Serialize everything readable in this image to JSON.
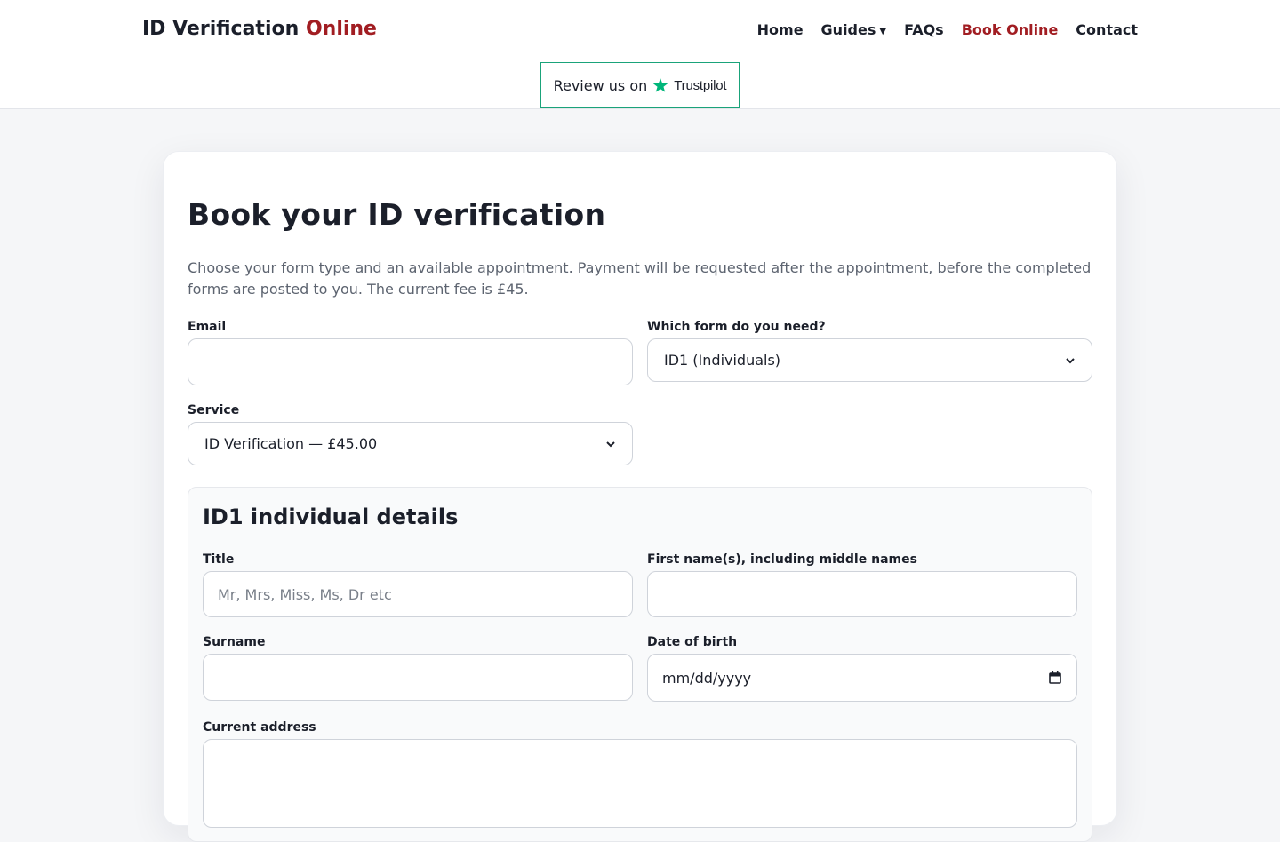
{
  "header": {
    "brand_main": "ID Verification",
    "brand_accent": "Online",
    "nav": [
      {
        "label": "Home"
      },
      {
        "label": "Guides",
        "has_dropdown": true
      },
      {
        "label": "FAQs"
      },
      {
        "label": "Book Online",
        "active": true
      },
      {
        "label": "Contact"
      }
    ],
    "trustpilot": {
      "prefix": "Review us on",
      "brand": "Trustpilot"
    }
  },
  "main": {
    "title": "Book your ID verification",
    "intro": "Choose your form type and an available appointment. Payment will be requested after the appointment, before the completed forms are posted to you. The current fee is £45.",
    "email": {
      "label": "Email",
      "value": "",
      "placeholder": ""
    },
    "form_type": {
      "label": "Which form do you need?",
      "selected": "ID1 (Individuals)"
    },
    "service": {
      "label": "Service",
      "selected": "ID Verification — £45.00"
    },
    "details": {
      "heading": "ID1 individual details",
      "title_field": {
        "label": "Title",
        "placeholder": "Mr, Mrs, Miss, Ms, Dr etc"
      },
      "first_names": {
        "label": "First name(s), including middle names",
        "value": ""
      },
      "surname": {
        "label": "Surname",
        "value": ""
      },
      "dob": {
        "label": "Date of birth",
        "placeholder": "mm/dd/yyyy"
      },
      "address": {
        "label": "Current address",
        "value": ""
      }
    }
  },
  "colors": {
    "accent": "#a11d22",
    "trustpilot_green": "#00b67a",
    "text": "#1b1f2a",
    "muted": "#5d6470"
  }
}
